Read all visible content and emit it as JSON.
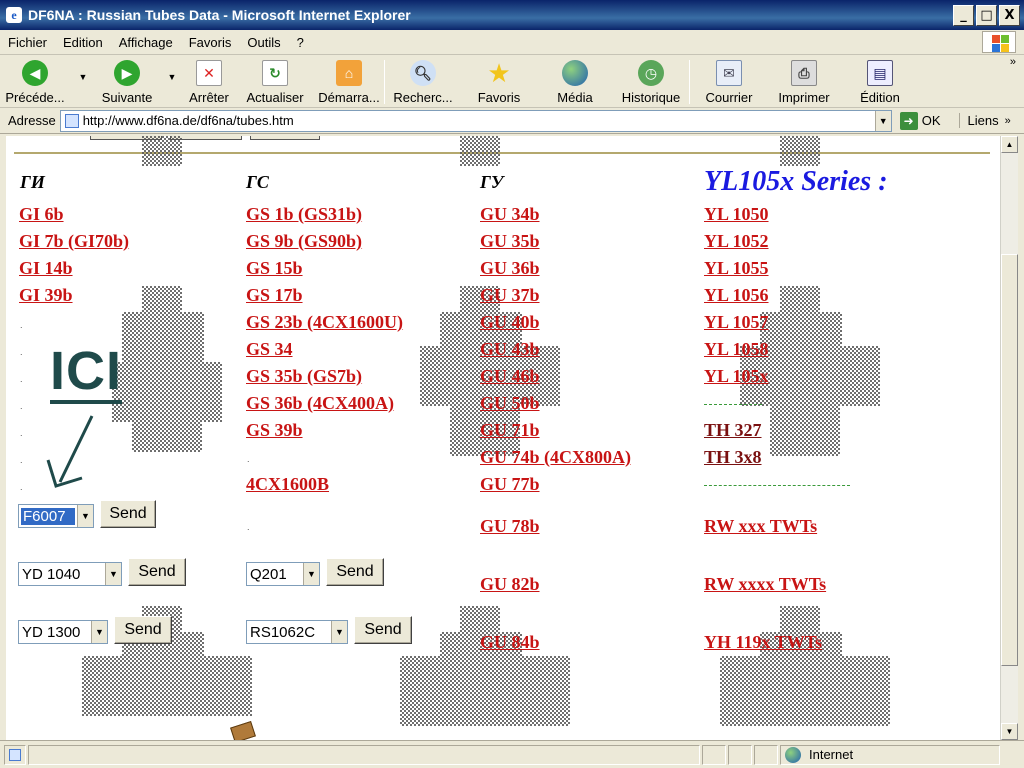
{
  "window": {
    "title": "DF6NA : Russian Tubes Data - Microsoft Internet Explorer",
    "min": "_",
    "max": "□",
    "close": "X"
  },
  "menu": [
    "Fichier",
    "Edition",
    "Affichage",
    "Favoris",
    "Outils",
    "?"
  ],
  "toolbar": {
    "back": "Précéde...",
    "forward": "Suivante",
    "stop": "Arrêter",
    "refresh": "Actualiser",
    "home": "Démarra...",
    "search": "Recherc...",
    "favorites": "Favoris",
    "media": "Média",
    "history": "Historique",
    "mail": "Courrier",
    "print": "Imprimer",
    "edit": "Édition"
  },
  "address": {
    "label": "Adresse",
    "url": "http://www.df6na.de/df6na/tubes.htm",
    "go": "OK",
    "links": "Liens"
  },
  "columns": {
    "gi": "ГИ",
    "gs": "ГС",
    "gu": "ГУ",
    "yl_series": "YL105x Series :"
  },
  "links": {
    "gi": [
      "GI 6b",
      "GI 7b (GI70b)",
      "GI 14b",
      "GI 39b"
    ],
    "gs": [
      "GS 1b (GS31b)",
      "GS 9b (GS90b)",
      "GS 15b",
      "GS 17b",
      "GS 23b (4CX1600U)",
      "GS 34",
      "GS 35b (GS7b)",
      "GS 36b (4CX400A)",
      "GS 39b",
      "4CX1600B"
    ],
    "gu": [
      "GU 34b",
      "GU 35b",
      "GU 36b",
      "GU 37b",
      "GU 40b",
      "GU 43b",
      "GU 46b",
      "GU 50b",
      "GU 71b",
      "GU 74b (4CX800A)",
      "GU 77b",
      "GU 78b",
      "GU 82b",
      "GU 84b"
    ],
    "yl": [
      "YL 1050",
      "YL 1052",
      "YL 1055",
      "YL 1056",
      "YL 1057",
      "YL 1058",
      "YL 105x"
    ],
    "th": [
      "TH 327",
      "TH 3x8"
    ],
    "twt": [
      "RW xxx   TWTs",
      "RW xxxx TWTs",
      "YH  119x TWTs"
    ]
  },
  "ici": "ICI",
  "forms": {
    "send": "Send",
    "sel1": "F6007",
    "sel2": "YD 1040",
    "sel3": "YD 1300",
    "sel4": "Q201",
    "sel5": "RS1062C"
  },
  "status": {
    "zone": "Internet"
  },
  "colors": {
    "link": "#c81414",
    "heading_blue": "#1a1ae0",
    "ici": "#1f4a4a"
  }
}
